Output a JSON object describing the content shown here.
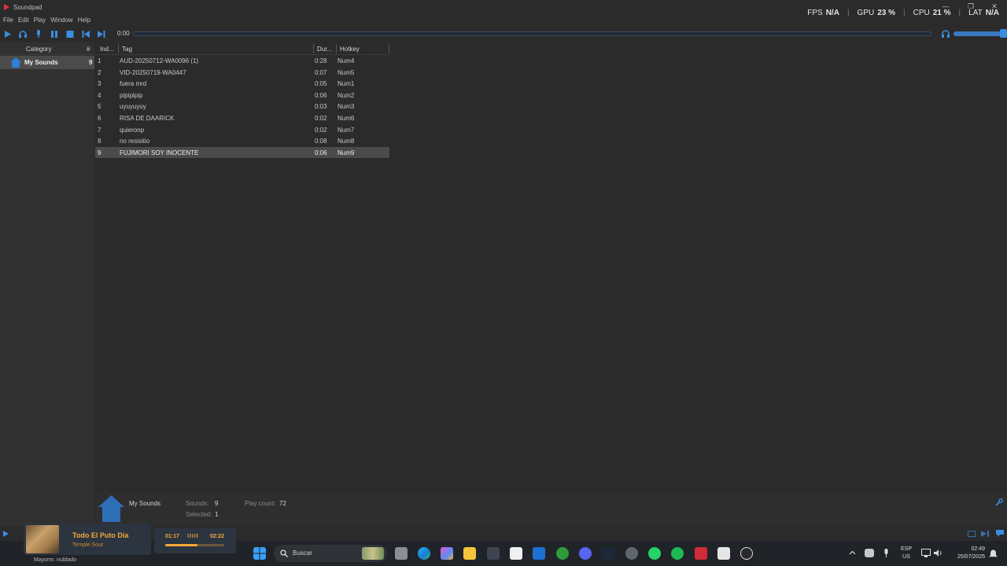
{
  "window": {
    "title": "Soundpad",
    "controls": [
      "—",
      "❐",
      "✕"
    ]
  },
  "overlay": {
    "fps_label": "FPS",
    "fps_value": "N/A",
    "gpu_label": "GPU",
    "gpu_value": "23 %",
    "cpu_label": "CPU",
    "cpu_value": "21 %",
    "lat_label": "LAT",
    "lat_value": "N/A"
  },
  "menu": [
    "File",
    "Edit",
    "Play",
    "Window",
    "Help"
  ],
  "toolbar": {
    "time": "0:00",
    "progress": 0,
    "volume": 0.92
  },
  "categories": {
    "header_label": "Category",
    "header_count": "#",
    "items": [
      {
        "name": "My Sounds",
        "count": "9"
      }
    ]
  },
  "table": {
    "headers": {
      "index": "Ind...",
      "tag": "Tag",
      "duration": "Dur...",
      "hotkey": "Hotkey"
    },
    "rows": [
      {
        "index": "1",
        "tag": "AUD-20250712-WA0096 (1)",
        "duration": "0:28",
        "hotkey": "Num4"
      },
      {
        "index": "2",
        "tag": "VID-20250719-WA0447",
        "duration": "0:07",
        "hotkey": "Num5"
      },
      {
        "index": "3",
        "tag": "fuera mrd",
        "duration": "0:05",
        "hotkey": "Num1"
      },
      {
        "index": "4",
        "tag": "pipipipip",
        "duration": "0:06",
        "hotkey": "Num2"
      },
      {
        "index": "5",
        "tag": "uyuyuyuy",
        "duration": "0:03",
        "hotkey": "Num3"
      },
      {
        "index": "6",
        "tag": "RISA DE DAARICK",
        "duration": "0:02",
        "hotkey": "Num6"
      },
      {
        "index": "7",
        "tag": "quieronp",
        "duration": "0:02",
        "hotkey": "Num7"
      },
      {
        "index": "8",
        "tag": "no resisitio",
        "duration": "0:08",
        "hotkey": "Num8"
      },
      {
        "index": "9",
        "tag": "FUJIMORI  SOY INOCENTE",
        "duration": "0:06",
        "hotkey": "Num9"
      }
    ],
    "selected_index": 8
  },
  "status": {
    "category": "My Sounds",
    "sounds_label": "Sounds:",
    "sounds_value": "9",
    "selected_label": "Selected:",
    "selected_value": "1",
    "playcount_label": "Play count:",
    "playcount_value": "72"
  },
  "media": {
    "title": "Todo El Puto Dia",
    "artist": "Temple Sour",
    "current": "01:17",
    "total": "02:22",
    "bars": "IIIII",
    "progress": 0.54
  },
  "taskbar": {
    "weather": "Mayorm. nublado",
    "search_placeholder": "Buscar",
    "lang_top": "ESP",
    "lang_bottom": "US",
    "time": "02:49",
    "date": "25/07/2025"
  },
  "colors": {
    "accent": "#3a8ee0",
    "media_accent": "#f4a93a"
  }
}
